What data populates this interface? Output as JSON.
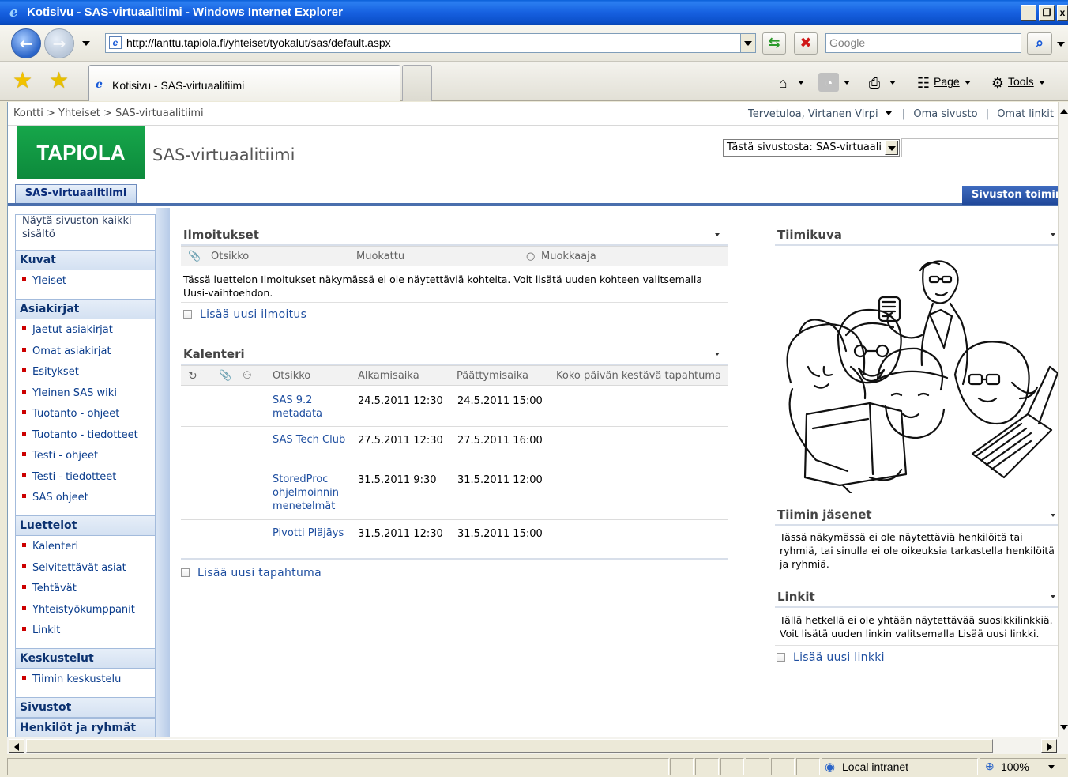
{
  "window": {
    "title": "Kotisivu - SAS-virtuaalitiimi - Windows Internet Explorer"
  },
  "addressbar": {
    "url": "http://lanttu.tapiola.fi/yhteiset/tyokalut/sas/default.aspx",
    "search_placeholder": "Google"
  },
  "commandbar": {
    "tab_label": "Kotisivu - SAS-virtuaalitiimi",
    "page_label": "Page",
    "tools_label": "Tools"
  },
  "sp": {
    "breadcrumb": "Kontti > Yhteiset > SAS-virtuaalitiimi",
    "welcome": "Tervetuloa, Virtanen Virpi",
    "my_site": "Oma sivusto",
    "my_links": "Omat linkit",
    "logo": "TAPIOLA",
    "site_title": "SAS-virtuaalitiimi",
    "search_scope": "Tästä sivustosta: SAS-virtuaali",
    "tab_site": "SAS-virtuaalitiimi",
    "site_actions": "Sivuston toiminnot"
  },
  "leftnav": {
    "view_all": "Näytä sivuston kaikki sisältö",
    "kuvat": "Kuvat",
    "kuvat_items": [
      "Yleiset"
    ],
    "asiakirjat": "Asiakirjat",
    "asiakirjat_items": [
      "Jaetut asiakirjat",
      "Omat asiakirjat",
      "Esitykset",
      "Yleinen SAS wiki",
      "Tuotanto - ohjeet",
      "Tuotanto - tiedotteet",
      "Testi - ohjeet",
      "Testi - tiedotteet",
      "SAS ohjeet"
    ],
    "luettelot": "Luettelot",
    "luettelot_items": [
      "Kalenteri",
      "Selvitettävät asiat",
      "Tehtävät",
      "Yhteistyökumppanit",
      "Linkit"
    ],
    "keskustelut": "Keskustelut",
    "keskustelut_items": [
      "Tiimin keskustelu"
    ],
    "sivustot": "Sivustot",
    "henkilot": "Henkilöt ja ryhmät"
  },
  "announcements": {
    "title": "Ilmoitukset",
    "col_title": "Otsikko",
    "col_modified": "Muokattu",
    "col_editor": "Muokkaaja",
    "empty_msg": "Tässä luettelon Ilmoitukset näkymässä ei ole näytettäviä kohteita. Voit lisätä uuden kohteen valitsemalla Uusi-vaihtoehdon.",
    "add_link": "Lisää uusi ilmoitus"
  },
  "calendar": {
    "title": "Kalenteri",
    "col_title": "Otsikko",
    "col_start": "Alkamisaika",
    "col_end": "Päättymisaika",
    "col_allday": "Koko päivän kestävä tapahtuma",
    "rows": [
      {
        "title": "SAS 9.2 metadata",
        "start": "24.5.2011 12:30",
        "end": "24.5.2011 15:00"
      },
      {
        "title": "SAS Tech Club",
        "start": "27.5.2011 12:30",
        "end": "27.5.2011 16:00"
      },
      {
        "title": "StoredProc ohjelmoinnin menetelmät",
        "start": "31.5.2011 9:30",
        "end": "31.5.2011 12:00"
      },
      {
        "title": "Pivotti Pläjäys",
        "start": "31.5.2011 12:30",
        "end": "31.5.2011 15:00"
      }
    ],
    "add_link": "Lisää uusi tapahtuma"
  },
  "teamimage": {
    "title": "Tiimikuva"
  },
  "members": {
    "title": "Tiimin jäsenet",
    "empty_msg": "Tässä näkymässä ei ole näytettäviä henkilöitä tai ryhmiä, tai sinulla ei ole oikeuksia tarkastella henkilöitä ja ryhmiä."
  },
  "links": {
    "title": "Linkit",
    "empty_msg": "Tällä hetkellä ei ole yhtään näytettävää suosikkilinkkiä. Voit lisätä uuden linkin valitsemalla Lisää uusi linkki.",
    "add_link": "Lisää uusi linkki"
  },
  "statusbar": {
    "zone": "Local intranet",
    "zoom": "100%"
  }
}
